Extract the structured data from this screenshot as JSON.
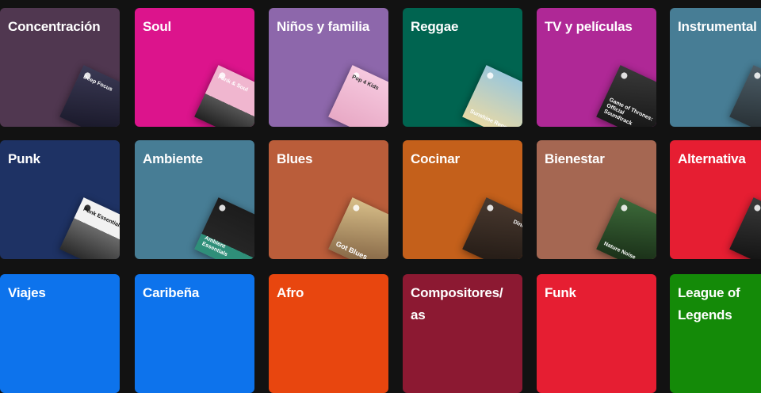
{
  "tiles": [
    {
      "label": "Concentración",
      "color": "#503750",
      "cover": "Deep Focus"
    },
    {
      "label": "Soul",
      "color": "#dc148c",
      "cover": "Funk & Soul"
    },
    {
      "label": "Niños y familia",
      "color": "#8d67ab",
      "cover": "Pop 4 Kids"
    },
    {
      "label": "Reggae",
      "color": "#006450",
      "cover": "Sunshine Reggae"
    },
    {
      "label": "TV y películas",
      "color": "#af2896",
      "cover": "Game of Thrones: Official Soundtrack"
    },
    {
      "label": "Instrumental",
      "color": "#477d95",
      "cover": ""
    },
    {
      "label": "Punk",
      "color": "#1e3264",
      "cover": "Punk Essentials"
    },
    {
      "label": "Ambiente",
      "color": "#477d95",
      "cover": "Ambient Essentials"
    },
    {
      "label": "Blues",
      "color": "#ba5d3a",
      "cover": "Got Blues"
    },
    {
      "label": "Cocinar",
      "color": "#c4601b",
      "cover": "Dinner"
    },
    {
      "label": "Bienestar",
      "color": "#a56752",
      "cover": "Nature Noise"
    },
    {
      "label": "Alternativa",
      "color": "#e61e32",
      "cover": ""
    },
    {
      "label": "Viajes",
      "color": "#0d73ec",
      "cover": ""
    },
    {
      "label": "Caribeña",
      "color": "#0d73ec",
      "cover": ""
    },
    {
      "label": "Afro",
      "color": "#e8460f",
      "cover": ""
    },
    {
      "label": "Compositores/ as",
      "color": "#8c1932",
      "cover": ""
    },
    {
      "label": "Funk",
      "color": "#e61e32",
      "cover": ""
    },
    {
      "label": "League of Legends",
      "color": "#148a08",
      "cover": ""
    }
  ],
  "covers_colors": [
    "#1b1a2e",
    "#d9b8c8",
    "#e8c3d6",
    "#7fb1c8",
    "#222222",
    "#35454f",
    "#e5e5e5",
    "#1f4f46",
    "#b9904a",
    "#3a2c23",
    "#24462a",
    "#2b2b2b"
  ]
}
